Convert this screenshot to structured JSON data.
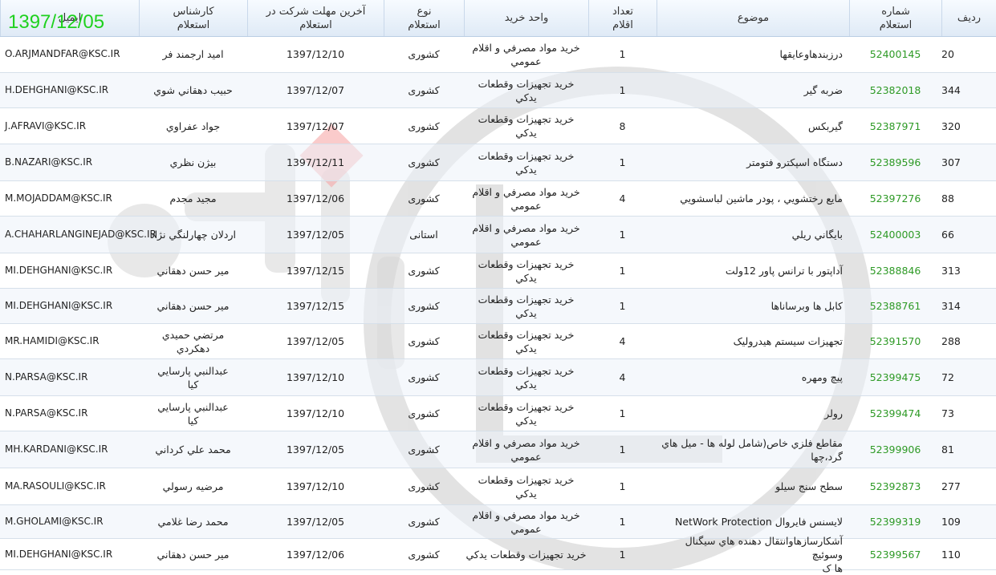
{
  "date_stamp": "1397/12/05",
  "headers": {
    "idx": "ردیف",
    "number": "شماره\nاستعلام",
    "subject": "موضوع",
    "count": "تعداد\nاقلام",
    "unit": "واحد خرید",
    "type": "نوع\nاستعلام",
    "deadline": "آخرین مهلت شرکت در\nاستعلام",
    "expert": "کارشناس\nاستعلام",
    "email": "ایمیل"
  },
  "rows": [
    {
      "idx": "20",
      "number": "52400145",
      "subject": "درزبندهاوعايقها",
      "count": "1",
      "unit": "خريد مواد مصرفي و اقلام\nعمومي",
      "type": "کشوری",
      "deadline": "1397/12/10",
      "expert": "امید ارجمند فر",
      "email": "O.ARJMANDFAR@KSC.IR"
    },
    {
      "idx": "344",
      "number": "52382018",
      "subject": "ضربه گير",
      "count": "1",
      "unit": "خريد تجهيزات وقطعات\nيدکي",
      "type": "کشوری",
      "deadline": "1397/12/07",
      "expert": "حبيب دهقاني شوي",
      "email": "H.DEHGHANI@KSC.IR"
    },
    {
      "idx": "320",
      "number": "52387971",
      "subject": "گيربکس",
      "count": "8",
      "unit": "خريد تجهيزات وقطعات\nيدکي",
      "type": "کشوری",
      "deadline": "1397/12/07",
      "expert": "جواد عفراوي",
      "email": "J.AFRAVI@KSC.IR"
    },
    {
      "idx": "307",
      "number": "52389596",
      "subject": "دستگاه اسپکترو فتومتر",
      "count": "1",
      "unit": "خريد تجهيزات وقطعات\nيدکي",
      "type": "کشوری",
      "deadline": "1397/12/11",
      "expert": "بيژن نظري",
      "email": "B.NAZARI@KSC.IR"
    },
    {
      "idx": "88",
      "number": "52397276",
      "subject": "مايع رختشويي ، پودر ماشين لباسشويي",
      "count": "4",
      "unit": "خريد مواد مصرفي و اقلام\nعمومي",
      "type": "کشوری",
      "deadline": "1397/12/06",
      "expert": "مجيد مجدم",
      "email": "M.MOJADDAM@KSC.IR"
    },
    {
      "idx": "66",
      "number": "52400003",
      "subject": "بايگاني ريلي",
      "count": "1",
      "unit": "خريد مواد مصرفي و اقلام\nعمومي",
      "type": "استانی",
      "deadline": "1397/12/05",
      "expert": "اردلان چهارلنگي نژاد",
      "email": "A.CHAHARLANGINEJAD@KSC.IR"
    },
    {
      "idx": "313",
      "number": "52388846",
      "subject": "آداپتور با ترانس پاور 12ولت",
      "count": "1",
      "unit": "خريد تجهيزات وقطعات\nيدکي",
      "type": "کشوری",
      "deadline": "1397/12/15",
      "expert": "مير حسن دهقاني",
      "email": "MI.DEHGHANI@KSC.IR"
    },
    {
      "idx": "314",
      "number": "52388761",
      "subject": "کابل ها وبرساناها",
      "count": "1",
      "unit": "خريد تجهيزات وقطعات\nيدکي",
      "type": "کشوری",
      "deadline": "1397/12/15",
      "expert": "مير حسن دهقاني",
      "email": "MI.DEHGHANI@KSC.IR"
    },
    {
      "idx": "288",
      "number": "52391570",
      "subject": "تجهيزات سيستم هيدروليک",
      "count": "4",
      "unit": "خريد تجهيزات وقطعات\nيدکي",
      "type": "کشوری",
      "deadline": "1397/12/05",
      "expert": "مرتضي حميدي\nدهکردي",
      "email": "MR.HAMIDI@KSC.IR"
    },
    {
      "idx": "72",
      "number": "52399475",
      "subject": "پيچ ومهره",
      "count": "4",
      "unit": "خريد تجهيزات وقطعات\nيدکي",
      "type": "کشوری",
      "deadline": "1397/12/10",
      "expert": "عبدالنبي پارسايي\nکيا",
      "email": "N.PARSA@KSC.IR"
    },
    {
      "idx": "73",
      "number": "52399474",
      "subject": "رولر",
      "count": "1",
      "unit": "خريد تجهيزات وقطعات\nيدکي",
      "type": "کشوری",
      "deadline": "1397/12/10",
      "expert": "عبدالنبي پارسايي\nکيا",
      "email": "N.PARSA@KSC.IR"
    },
    {
      "idx": "81",
      "number": "52399906",
      "subject": "مقاطع فلزي خاص(شامل لوله ها - ميل هاي\nگرد،چها",
      "count": "1",
      "unit": "خريد مواد مصرفي و اقلام\nعمومي",
      "type": "کشوری",
      "deadline": "1397/12/05",
      "expert": "محمد علي کرداني",
      "email": "MH.KARDANI@KSC.IR"
    },
    {
      "idx": "277",
      "number": "52392873",
      "subject": "سطح سنج سيلو",
      "count": "1",
      "unit": "خريد تجهيزات وقطعات\nيدکي",
      "type": "کشوری",
      "deadline": "1397/12/10",
      "expert": "مرضيه رسولي",
      "email": "MA.RASOULI@KSC.IR"
    },
    {
      "idx": "109",
      "number": "52399319",
      "subject": "لايسنس فايروال NetWork Protection",
      "count": "1",
      "unit": "خريد مواد مصرفي و اقلام\nعمومي",
      "type": "کشوری",
      "deadline": "1397/12/05",
      "expert": "محمد رضا غلامي",
      "email": "M.GHOLAMI@KSC.IR"
    },
    {
      "idx": "110",
      "number": "52399567",
      "subject": "آشکارسازهاوانتقال دهنده هاي سيگنال وسوئيچ\nها ک",
      "count": "1",
      "unit": "خريد تجهيزات وقطعات يدکي",
      "type": "کشوری",
      "deadline": "1397/12/06",
      "expert": "مير حسن دهقاني",
      "email": "MI.DEHGHANI@KSC.IR"
    }
  ]
}
